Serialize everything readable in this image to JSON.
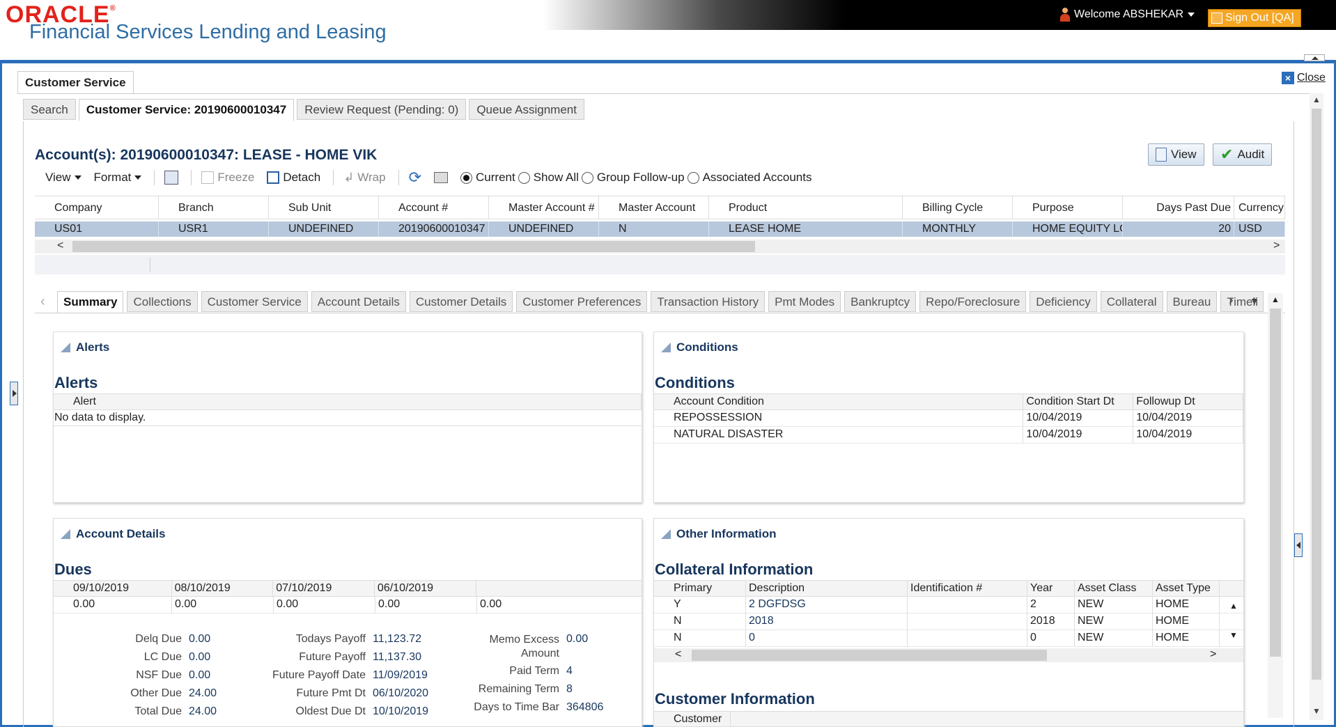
{
  "header": {
    "logo_oracle": "ORACLE",
    "logo_subtitle": "Financial Services Lending and Leasing",
    "welcome": "Welcome ABSHEKAR",
    "sign_out": "Sign Out [QA]"
  },
  "page": {
    "main_tab": "Customer Service",
    "close_label": "Close",
    "sub_tabs": [
      "Search",
      "Customer Service: 20190600010347",
      "Review Request (Pending: 0)",
      "Queue Assignment"
    ]
  },
  "account": {
    "title": "Account(s): 20190600010347: LEASE - HOME VIK",
    "view_btn": "View",
    "audit_btn": "Audit",
    "toolbar": {
      "view": "View",
      "format": "Format",
      "freeze": "Freeze",
      "detach": "Detach",
      "wrap": "Wrap"
    },
    "radios": [
      "Current",
      "Show All",
      "Group Follow-up",
      "Associated Accounts"
    ],
    "selected_radio": "Current",
    "columns": [
      "Company",
      "Branch",
      "Sub Unit",
      "Account #",
      "Master Account #",
      "Master Account",
      "Product",
      "Billing Cycle",
      "Purpose",
      "Days Past Due",
      "Currency"
    ],
    "row": [
      "US01",
      "USR1",
      "UNDEFINED",
      "20190600010347",
      "UNDEFINED",
      "N",
      "LEASE HOME",
      "MONTHLY",
      "HOME EQUITY LO...",
      "20",
      "USD"
    ]
  },
  "section_tabs": [
    "Summary",
    "Collections",
    "Customer Service",
    "Account Details",
    "Customer Details",
    "Customer Preferences",
    "Transaction History",
    "Pmt Modes",
    "Bankruptcy",
    "Repo/Foreclosure",
    "Deficiency",
    "Collateral",
    "Bureau",
    "Timeli"
  ],
  "alerts": {
    "header": "Alerts",
    "title": "Alerts",
    "column": "Alert",
    "empty": "No data to display."
  },
  "conditions": {
    "header": "Conditions",
    "title": "Conditions",
    "columns": [
      "Account Condition",
      "Condition Start Dt",
      "Followup Dt"
    ],
    "rows": [
      [
        "REPOSSESSION",
        "10/04/2019",
        "10/04/2019"
      ],
      [
        "NATURAL DISASTER",
        "10/04/2019",
        "10/04/2019"
      ]
    ]
  },
  "account_details": {
    "header": "Account Details",
    "dues_title": "Dues",
    "dues_columns": [
      "09/10/2019",
      "08/10/2019",
      "07/10/2019",
      "06/10/2019",
      ""
    ],
    "dues_values": [
      "0.00",
      "0.00",
      "0.00",
      "0.00",
      "0.00"
    ],
    "col1": [
      {
        "k": "Delq Due",
        "v": "0.00"
      },
      {
        "k": "LC Due",
        "v": "0.00"
      },
      {
        "k": "NSF Due",
        "v": "0.00"
      },
      {
        "k": "Other Due",
        "v": "24.00"
      },
      {
        "k": "Total Due",
        "v": "24.00"
      }
    ],
    "col2": [
      {
        "k": "Todays Payoff",
        "v": "11,123.72"
      },
      {
        "k": "Future Payoff",
        "v": "11,137.30"
      },
      {
        "k": "Future Payoff Date",
        "v": "11/09/2019"
      },
      {
        "k": "Future Pmt Dt",
        "v": "06/10/2020"
      },
      {
        "k": "Oldest Due Dt",
        "v": "10/10/2019"
      }
    ],
    "col3": [
      {
        "k": "Memo Excess",
        "k2": "Amount",
        "v": "0.00"
      },
      {
        "k": "Paid Term",
        "v": "4"
      },
      {
        "k": "Remaining Term",
        "v": "8"
      },
      {
        "k": "Days to Time Bar",
        "v": "364806"
      }
    ]
  },
  "other_info": {
    "header": "Other Information",
    "collateral_title": "Collateral Information",
    "columns": [
      "Primary",
      "Description",
      "Identification #",
      "Year",
      "Asset Class",
      "Asset Type"
    ],
    "rows": [
      [
        "Y",
        "2 DGFDSG",
        "",
        "2",
        "NEW",
        "HOME"
      ],
      [
        "N",
        "2018",
        "",
        "2018",
        "NEW",
        "HOME"
      ],
      [
        "N",
        "0",
        "",
        "0",
        "NEW",
        "HOME"
      ]
    ],
    "customer_title": "Customer Information",
    "customer_col": "Customer"
  }
}
